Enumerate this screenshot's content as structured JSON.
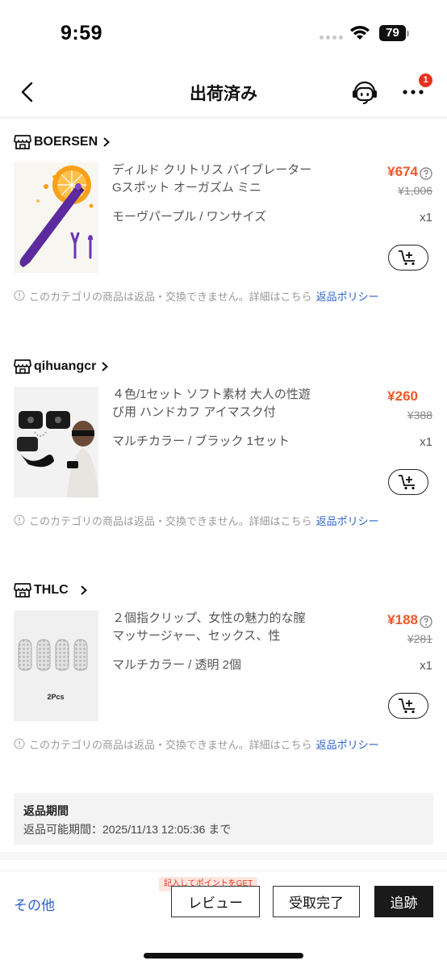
{
  "status_bar": {
    "time": "9:59",
    "battery": "79"
  },
  "nav": {
    "title": "出荷済み",
    "badge_count": "1"
  },
  "stores": [
    {
      "name": "BOERSEN",
      "product": {
        "title": "ディルド クリトリス バイブレーター Gスポット オーガズム ミニ",
        "variant": "モーヴパープル / ワンサイズ",
        "price": "¥674",
        "original_price": "¥1,006",
        "quantity": "x1"
      },
      "policy_text": "このカテゴリの商品は返品・交換できません。詳細はこちら",
      "policy_link": "返品ポリシー"
    },
    {
      "name": "qihuangcr",
      "product": {
        "title": "４色/1セット ソフト素材 大人の性遊び用 ハンドカフ アイマスク付",
        "variant": "マルチカラー / ブラック 1セット",
        "price": "¥260",
        "original_price": "¥388",
        "quantity": "x1"
      },
      "policy_text": "このカテゴリの商品は返品・交換できません。詳細はこちら",
      "policy_link": "返品ポリシー"
    },
    {
      "name": "THLC",
      "product": {
        "title": "２個指クリップ、女性の魅力的な膣マッサージャー、セックス、性",
        "variant": "マルチカラー / 透明 2個",
        "price": "¥188",
        "original_price": "¥281",
        "quantity": "x1",
        "image_label": "2Pcs"
      },
      "policy_text": "このカテゴリの商品は返品・交換できません。詳細はこちら",
      "policy_link": "返品ポリシー"
    }
  ],
  "return_period": {
    "title": "返品期間",
    "text": "返品可能期間：2025/11/13 12:05:36 まで"
  },
  "bottom_bar": {
    "other": "その他",
    "promo": "記入してポイントをGET",
    "review": "レビュー",
    "received": "受取完了",
    "track": "追跡"
  },
  "colors": {
    "price": "#f0582a",
    "link": "#2b63c8",
    "badge": "#e8321e",
    "primary_button": "#1a1a1a"
  }
}
